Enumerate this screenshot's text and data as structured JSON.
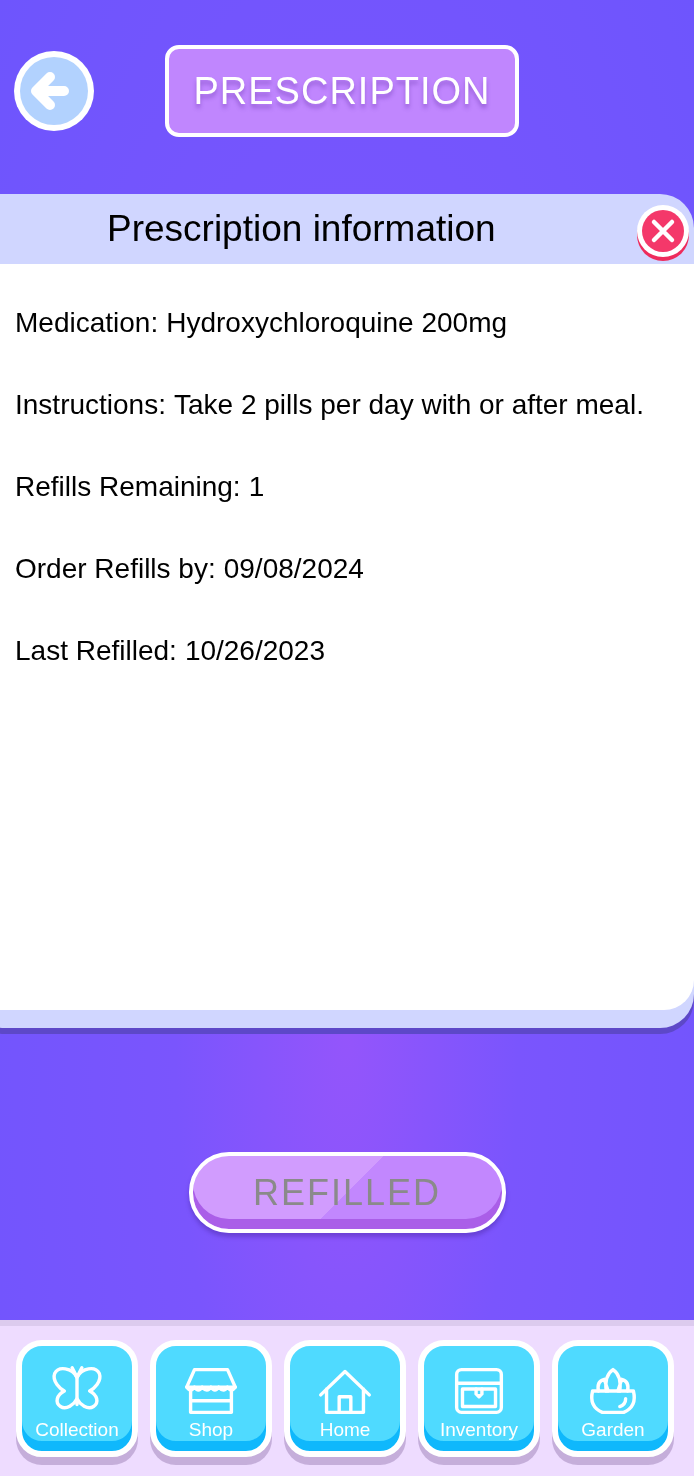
{
  "header": {
    "title": "PRESCRIPTION"
  },
  "card": {
    "title": "Prescription information",
    "fields": [
      {
        "label": "Medication:",
        "value": "Hydroxychloroquine 200mg"
      },
      {
        "label": "Instructions:",
        "value": "Take 2 pills per day with or after meal."
      },
      {
        "label": "Refills Remaining:",
        "value": "1"
      },
      {
        "label": "Order Refills by:",
        "value": "09/08/2024"
      },
      {
        "label": "Last Refilled:",
        "value": "10/26/2023"
      }
    ]
  },
  "action_button": {
    "label": "REFILLED",
    "disabled": true
  },
  "nav": [
    {
      "label": "Collection",
      "kind": "butterfly"
    },
    {
      "label": "Shop",
      "kind": "shop"
    },
    {
      "label": "Home",
      "kind": "home"
    },
    {
      "label": "Inventory",
      "kind": "chest"
    },
    {
      "label": "Garden",
      "kind": "plant"
    }
  ]
}
